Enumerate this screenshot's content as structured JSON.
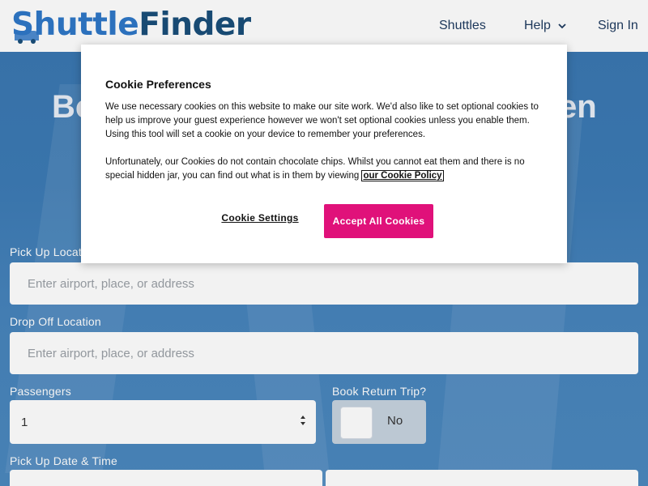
{
  "header": {
    "logo_part1": "Shuttle",
    "logo_part2": "Finder",
    "nav": {
      "shuttles": "Shuttles",
      "help": "Help",
      "sign_in": "Sign In"
    }
  },
  "hero": {
    "title_left": "Bo",
    "title_right": "en"
  },
  "form": {
    "pickup_label": "Pick Up Location",
    "pickup_placeholder": "Enter airport, place, or address",
    "dropoff_label": "Drop Off Location",
    "dropoff_placeholder": "Enter airport, place, or address",
    "passengers_label": "Passengers",
    "passengers_value": "1",
    "return_label": "Book Return Trip?",
    "return_value": "No",
    "date_label": "Pick Up Date & Time"
  },
  "cookie_modal": {
    "title": "Cookie Preferences",
    "paragraph1": "We use necessary cookies on this website to make our site work. We'd also like to set optional cookies to help us improve your guest experience however we won't set optional cookies unless you enable them. Using this tool will set a cookie on your device to remember your preferences.",
    "paragraph2": "Unfortunately, our Cookies do not contain chocolate chips. Whilst you cannot eat them and there is no special hidden jar, you can find out what is in them by viewing ",
    "policy_link": "our Cookie Policy",
    "settings_button": "Cookie Settings",
    "accept_button": "Accept All Cookies"
  },
  "colors": {
    "brand_blue": "#2f78c8",
    "brand_dark": "#1a4f7a",
    "accept_pink": "#e0117a",
    "hero_blue": "#3d7bb5"
  }
}
